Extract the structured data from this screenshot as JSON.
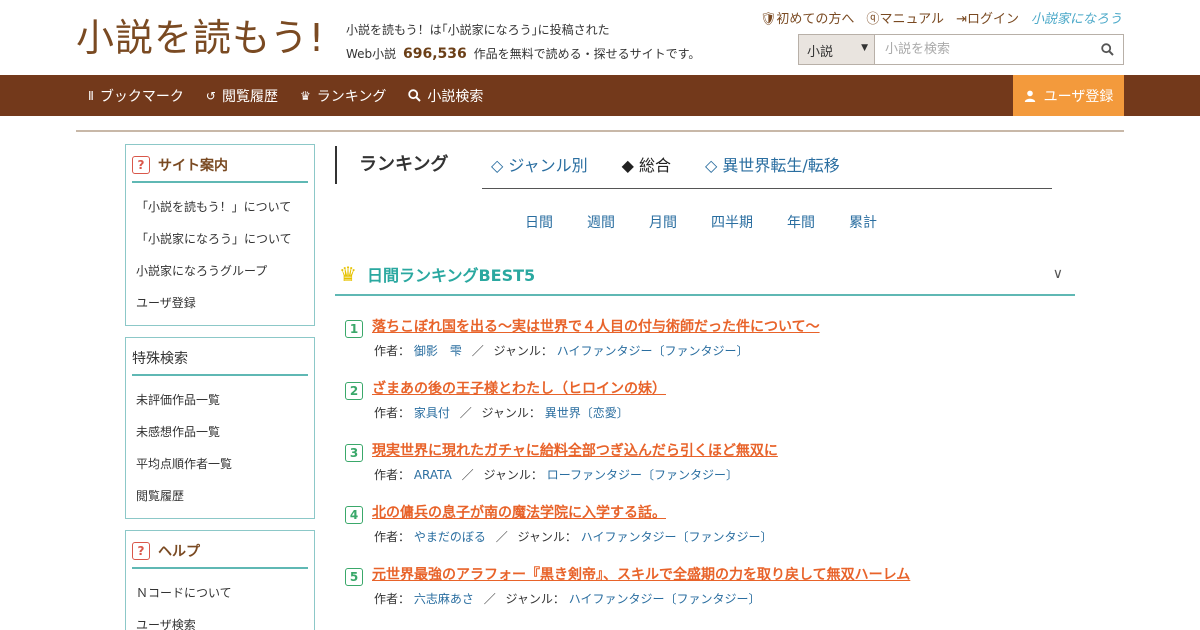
{
  "header": {
    "logo": "小説を読もう!",
    "tagline_line1": "小説を読もう！は｢小説家になろう｣に投稿された",
    "tagline_prefix": "Web小説",
    "work_count": "696,536",
    "tagline_suffix": "作品を無料で読める・探せるサイトです。",
    "top_links": [
      {
        "label": "初めての方へ",
        "icon": "shield-icon"
      },
      {
        "label": "マニュアル",
        "icon": "question-icon"
      },
      {
        "label": "ログイン",
        "icon": "login-icon"
      }
    ],
    "partner_logo": "小説家になろう",
    "search": {
      "category": "小説",
      "placeholder": "小説を検索"
    }
  },
  "nav": {
    "items": [
      {
        "label": "ブックマーク",
        "icon": "bookmark-icon"
      },
      {
        "label": "閲覧履歴",
        "icon": "history-icon"
      },
      {
        "label": "ランキング",
        "icon": "crown-icon"
      },
      {
        "label": "小説検索",
        "icon": "search-icon"
      }
    ],
    "register": "ユーザ登録"
  },
  "sidebar": {
    "boxes": [
      {
        "title": "サイト案内",
        "items": [
          "「小説を読もう！」について",
          "「小説家になろう」について",
          "小説家になろうグループ",
          "ユーザ登録"
        ]
      },
      {
        "title": "特殊検索",
        "items": [
          "未評価作品一覧",
          "未感想作品一覧",
          "平均点順作者一覧",
          "閲覧履歴"
        ]
      },
      {
        "title": "ヘルプ",
        "items": [
          "Ｎコードについて",
          "ユーザ検索"
        ]
      }
    ]
  },
  "ranking": {
    "title": "ランキング",
    "tabs": [
      {
        "label": "◇ ジャンル別",
        "active": false
      },
      {
        "label": "◆ 総合",
        "active": true
      },
      {
        "label": "◇ 異世界転生/転移",
        "active": false
      }
    ],
    "periods": [
      "日間",
      "週間",
      "月間",
      "四半期",
      "年間",
      "累計"
    ],
    "best_title": "日間ランキングBEST5",
    "author_label": "作者：",
    "genre_label": "ジャンル：",
    "items": [
      {
        "num": "1",
        "title": "落ちこぼれ国を出る〜実は世界で４人目の付与術師だった件について〜",
        "author": "御影　雫",
        "genre": "ハイファンタジー〔ファンタジー〕"
      },
      {
        "num": "2",
        "title": "ざまあの後の王子様とわたし（ヒロインの妹）",
        "author": "家具付",
        "genre": "異世界〔恋愛〕"
      },
      {
        "num": "3",
        "title": "現実世界に現れたガチャに給料全部つぎ込んだら引くほど無双に",
        "author": "ARATA",
        "genre": "ローファンタジー〔ファンタジー〕"
      },
      {
        "num": "4",
        "title": "北の傭兵の息子が南の魔法学院に入学する話。",
        "author": "やまだのぼる",
        "genre": "ハイファンタジー〔ファンタジー〕"
      },
      {
        "num": "5",
        "title": "元世界最強のアラフォー『黒き剣帝』、スキルで全盛期の力を取り戻して無双ハーレム",
        "author": "六志麻あさ",
        "genre": "ハイファンタジー〔ファンタジー〕"
      }
    ]
  }
}
